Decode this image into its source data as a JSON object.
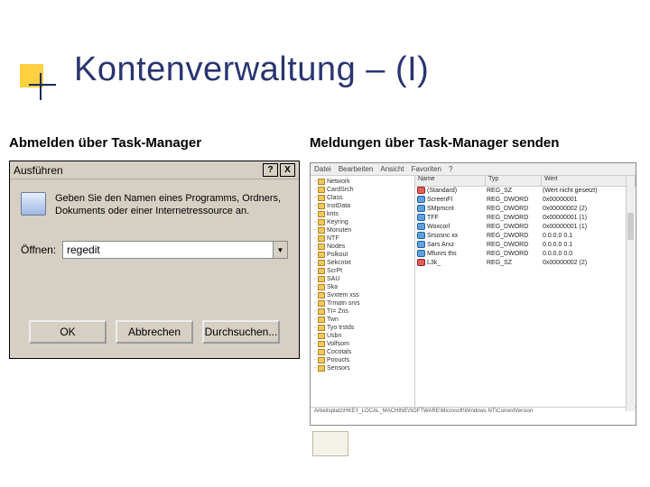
{
  "slide": {
    "title": "Kontenverwaltung – (I)",
    "subtitle_left": "Abmelden über Task-Manager",
    "subtitle_right": "Meldungen über Task-Manager senden"
  },
  "run_dialog": {
    "title": "Ausführen",
    "help_btn": "?",
    "close_btn": "X",
    "prompt": "Geben Sie den Namen eines Programms, Ordners, Dokuments oder einer Internetressource an.",
    "open_label": "Öffnen:",
    "input_value": "regedit",
    "btn_ok": "OK",
    "btn_cancel": "Abbrechen",
    "btn_browse": "Durchsuchen..."
  },
  "regedit": {
    "menu": [
      "Datei",
      "Bearbeiten",
      "Ansicht",
      "Favoriten",
      "?"
    ],
    "columns": {
      "name": "Name",
      "type": "Typ",
      "data": "Wert"
    },
    "tree": [
      "Network",
      "CardSrch",
      "Class",
      "InstData",
      "knts",
      "Keyring",
      "Monuten",
      "NTF",
      "Nodes",
      "Polkout",
      "Sekcntxt",
      "ScrPt",
      "SAU",
      "Ska",
      "Svxtem  xss",
      "Trmatn  srvs",
      "TI= Zns",
      "Twn",
      "Tyo  trstds",
      "Usbn",
      "Volfsom",
      "Cocotals",
      "Pooucts",
      "Sensors"
    ],
    "values": [
      {
        "ico": "str",
        "name": "(Standard)",
        "type": "REG_SZ",
        "data": "(Wert nicht gesetzt)"
      },
      {
        "ico": "bin",
        "name": "ScreenFl",
        "type": "REG_DWORD",
        "data": "0x00000001"
      },
      {
        "ico": "bin",
        "name": "SMpmcnt",
        "type": "REG_DWORD",
        "data": "0x00000002 (2)"
      },
      {
        "ico": "bin",
        "name": "TFF",
        "type": "REG_DWORD",
        "data": "0x00000001 (1)"
      },
      {
        "ico": "bin",
        "name": "Woxcorl",
        "type": "REG_DWORD",
        "data": "0x00000001 (1)"
      },
      {
        "ico": "bin",
        "name": "Srsosnc xx",
        "type": "REG_DWORD",
        "data": "0.0.0.0 0.1"
      },
      {
        "ico": "bin",
        "name": "Sars Arxz",
        "type": "REG_DWORD",
        "data": "0.0.0.0 0.1"
      },
      {
        "ico": "bin",
        "name": "Mfunrs ths",
        "type": "REG_DWORD",
        "data": "0.0.0.0 0.0"
      },
      {
        "ico": "str",
        "name": "L3k_",
        "type": "REG_SZ",
        "data": "0x00000002 (2)"
      }
    ],
    "status": "Arbeitsplatz\\HKEY_LOCAL_MACHINE\\SOFTWARE\\Microsoft\\Windows NT\\CurrentVersion"
  }
}
